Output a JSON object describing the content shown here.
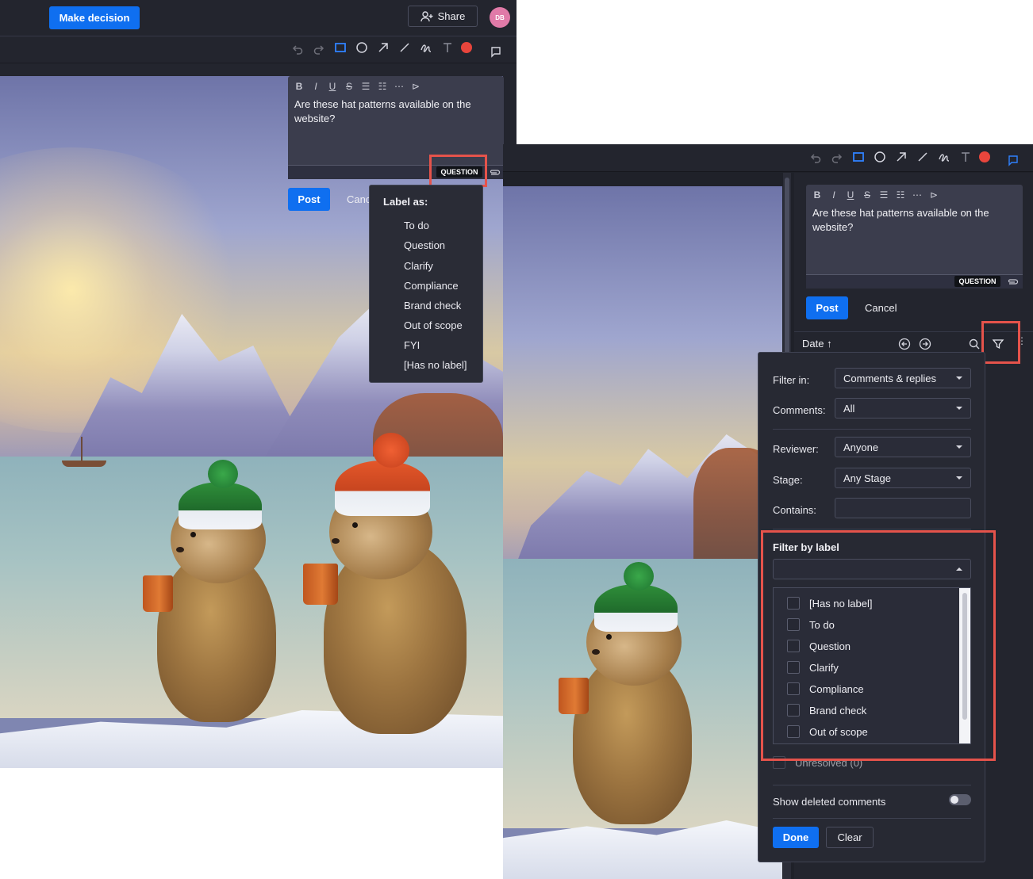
{
  "topbar": {
    "make_decision": "Make decision",
    "share": "Share",
    "avatar_initials": "DB"
  },
  "comment_editor": {
    "text": "Are these hat patterns available on the website?",
    "label_badge": "QUESTION",
    "post": "Post",
    "cancel": "Cancel",
    "cancel_truncated": "Canc"
  },
  "label_menu": {
    "heading": "Label as:",
    "items": [
      "To do",
      "Question",
      "Clarify",
      "Compliance",
      "Brand check",
      "Out of scope",
      "FYI",
      "[Has no label]"
    ]
  },
  "sort_bar": {
    "sort_label": "Date ↑"
  },
  "filter_panel": {
    "filter_in_label": "Filter in:",
    "filter_in_value": "Comments & replies",
    "comments_label": "Comments:",
    "comments_value": "All",
    "reviewer_label": "Reviewer:",
    "reviewer_value": "Anyone",
    "stage_label": "Stage:",
    "stage_value": "Any Stage",
    "contains_label": "Contains:",
    "contains_value": "",
    "filter_by_label_heading": "Filter by label",
    "label_options": [
      "[Has no label]",
      "To do",
      "Question",
      "Clarify",
      "Compliance",
      "Brand check",
      "Out of scope"
    ],
    "unresolved_text": "Unresolved (0)",
    "show_deleted": "Show deleted comments",
    "show_deleted_on": false,
    "done": "Done",
    "clear": "Clear"
  },
  "colors": {
    "accent": "#0f6ff0",
    "highlight": "#e5534b",
    "record": "#e8453c",
    "avatar": "#e07aa8"
  }
}
